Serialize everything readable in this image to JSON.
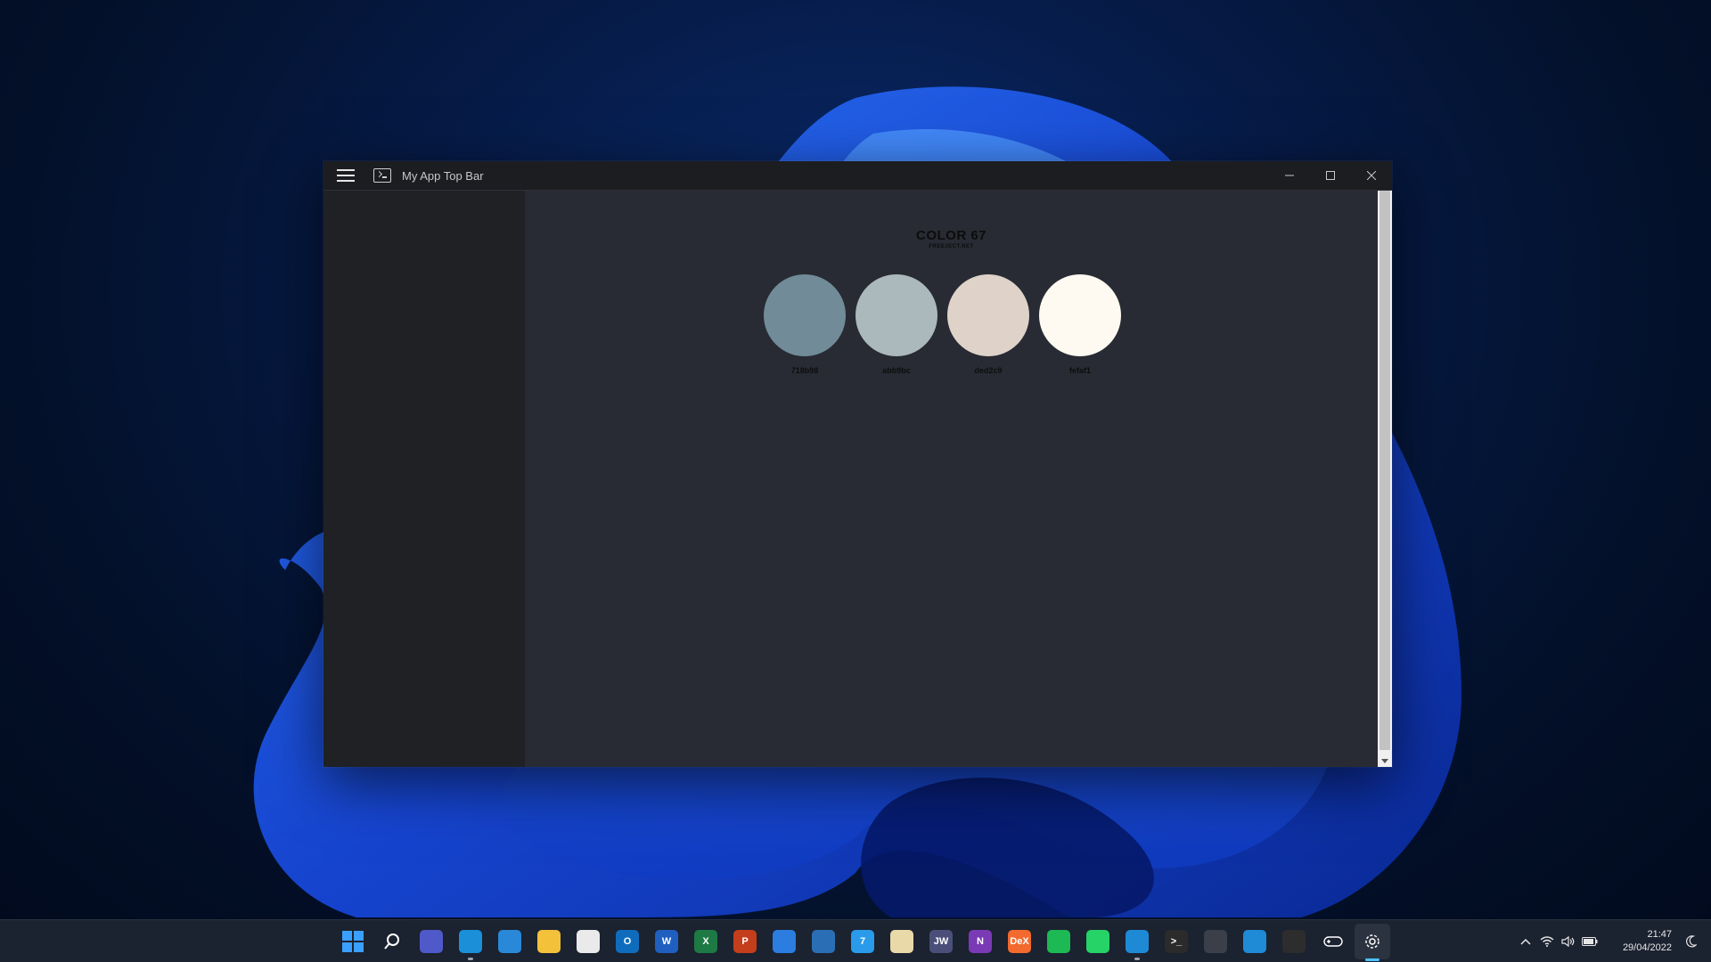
{
  "window": {
    "title": "My App Top Bar"
  },
  "palette": {
    "title": "COLOR 67",
    "subtitle": "FREEJECT.NET",
    "swatches": [
      {
        "label": "718b98",
        "color": "#718b98"
      },
      {
        "label": "abb9bc",
        "color": "#abb9bc"
      },
      {
        "label": "ded2c9",
        "color": "#ded2c9"
      },
      {
        "label": "fefaf1",
        "color": "#fefaf1"
      }
    ]
  },
  "taskbar": {
    "apps": [
      {
        "name": "start-icon",
        "glyph": "",
        "bg": "#1b2230",
        "fg": "#3aa0ff"
      },
      {
        "name": "search-icon",
        "glyph": "",
        "bg": "#1b2230",
        "fg": "#ffffff"
      },
      {
        "name": "teams-chat-icon",
        "glyph": "",
        "bg": "#5059c9",
        "fg": "#ffffff"
      },
      {
        "name": "edge-icon",
        "glyph": "",
        "bg": "#1b8fd8",
        "fg": "#ffffff"
      },
      {
        "name": "mail-icon",
        "glyph": "",
        "bg": "#2a88d8",
        "fg": "#ffffff"
      },
      {
        "name": "file-explorer-icon",
        "glyph": "",
        "bg": "#f3c13a",
        "fg": "#ffffff"
      },
      {
        "name": "microsoft-store-icon",
        "glyph": "",
        "bg": "#eaeaea",
        "fg": "#333"
      },
      {
        "name": "outlook-icon",
        "glyph": "O",
        "bg": "#0f6cbd",
        "fg": "#ffffff"
      },
      {
        "name": "word-icon",
        "glyph": "W",
        "bg": "#1f5fbf",
        "fg": "#ffffff"
      },
      {
        "name": "excel-icon",
        "glyph": "X",
        "bg": "#1d7a44",
        "fg": "#ffffff"
      },
      {
        "name": "powerpoint-icon",
        "glyph": "P",
        "bg": "#c43e1c",
        "fg": "#ffffff"
      },
      {
        "name": "calendar-icon",
        "glyph": "",
        "bg": "#2b7de0",
        "fg": "#ffffff"
      },
      {
        "name": "steam-icon",
        "glyph": "",
        "bg": "#2a6fb5",
        "fg": "#ffffff"
      },
      {
        "name": "twitter-icon",
        "glyph": "7",
        "bg": "#2a9bea",
        "fg": "#ffffff"
      },
      {
        "name": "notepad-icon",
        "glyph": "",
        "bg": "#e9d9a8",
        "fg": "#333"
      },
      {
        "name": "jw-icon",
        "glyph": "JW",
        "bg": "#4a4f7a",
        "fg": "#ffffff"
      },
      {
        "name": "onenote-icon",
        "glyph": "N",
        "bg": "#7b3ab5",
        "fg": "#ffffff"
      },
      {
        "name": "dex-icon",
        "glyph": "DeX",
        "bg": "#f26a2e",
        "fg": "#ffffff"
      },
      {
        "name": "spotify-icon",
        "glyph": "",
        "bg": "#1db954",
        "fg": "#ffffff"
      },
      {
        "name": "whatsapp-icon",
        "glyph": "",
        "bg": "#25d366",
        "fg": "#ffffff"
      },
      {
        "name": "vscode-icon",
        "glyph": "",
        "bg": "#1e8ad6",
        "fg": "#ffffff"
      },
      {
        "name": "terminal-icon",
        "glyph": ">_",
        "bg": "#2b2b2b",
        "fg": "#ffffff"
      },
      {
        "name": "davinci-resolve-icon",
        "glyph": "",
        "bg": "#3a3f4a",
        "fg": "#ffffff"
      },
      {
        "name": "trello-icon",
        "glyph": "",
        "bg": "#1f8ad6",
        "fg": "#ffffff"
      },
      {
        "name": "obs-icon",
        "glyph": "",
        "bg": "#2d2d2d",
        "fg": "#ffffff"
      },
      {
        "name": "controller-icon",
        "glyph": "",
        "bg": "#1b2230",
        "fg": "#ffffff"
      },
      {
        "name": "settings-icon",
        "glyph": "",
        "bg": "#1b2230",
        "fg": "#ffffff"
      }
    ]
  },
  "clock": {
    "time": "21:47",
    "date": "29/04/2022"
  }
}
